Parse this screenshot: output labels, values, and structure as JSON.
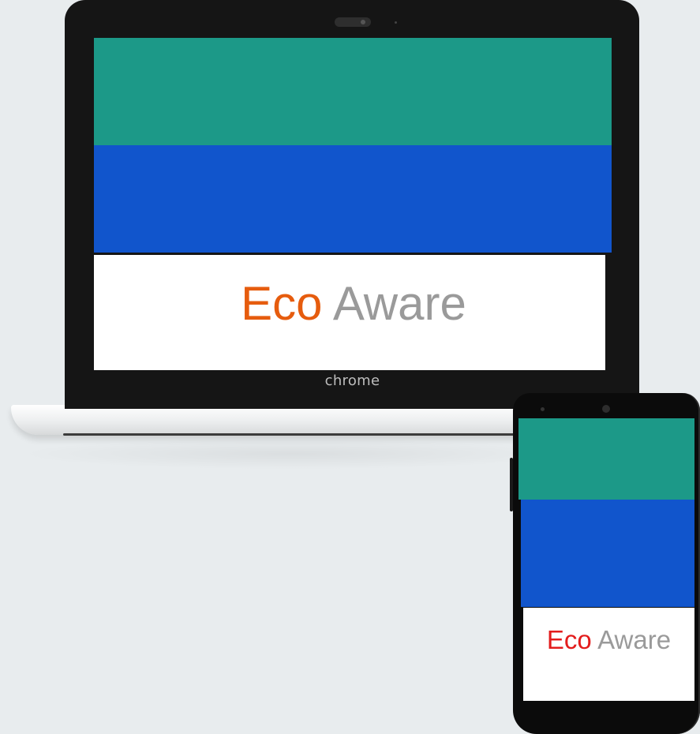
{
  "laptop": {
    "brand_eco": "Eco",
    "brand_aware": "Aware",
    "logo_text": "chrome"
  },
  "phone": {
    "brand_eco": "Eco",
    "brand_aware": "Aware"
  },
  "colors": {
    "background": "#e8ecee",
    "teal": "#1c9988",
    "blue": "#1155cc",
    "eco_laptop": "#e65c0e",
    "eco_phone": "#e31c1c",
    "aware": "#9a9a9a"
  }
}
